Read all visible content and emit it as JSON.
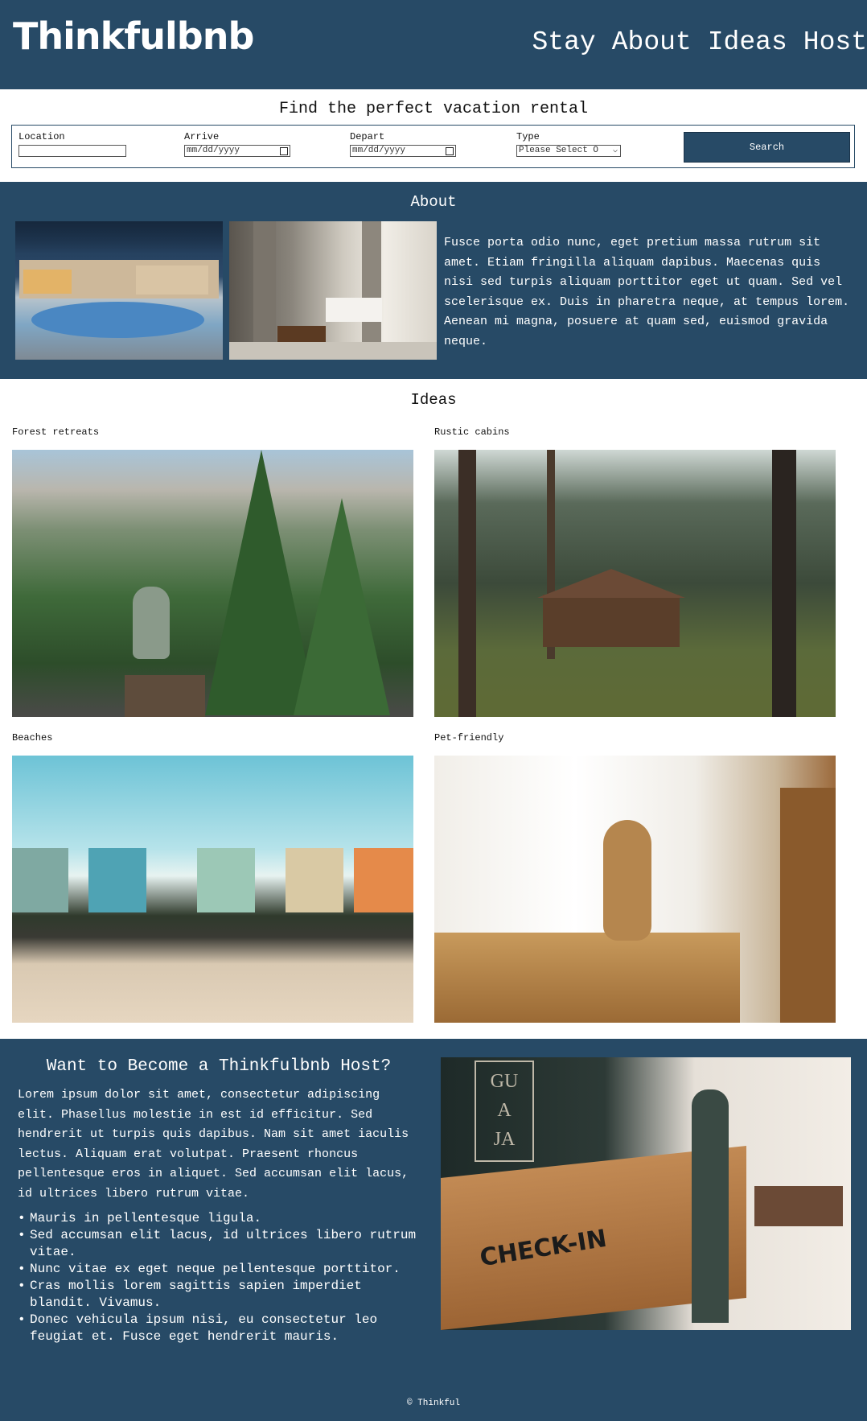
{
  "header": {
    "logo": "Thinkfulbnb",
    "nav": [
      "Stay",
      "About",
      "Ideas",
      "Host"
    ]
  },
  "search": {
    "title": "Find the perfect vacation rental",
    "location_label": "Location",
    "arrive_label": "Arrive",
    "arrive_placeholder": "mm/dd/yyyy",
    "depart_label": "Depart",
    "depart_placeholder": "mm/dd/yyyy",
    "type_label": "Type",
    "type_selected": "Please Select O",
    "button": "Search"
  },
  "about": {
    "title": "About",
    "text": "Fusce porta odio nunc, eget pretium massa rutrum sit amet. Etiam fringilla aliquam dapibus. Maecenas quis nisi sed turpis aliquam porttitor eget ut quam. Sed vel scelerisque ex. Duis in pharetra neque, at tempus lorem. Aenean mi magna, posuere at quam sed, euismod gravida neque."
  },
  "ideas": {
    "title": "Ideas",
    "items": [
      {
        "label": "Forest retreats"
      },
      {
        "label": "Rustic cabins"
      },
      {
        "label": "Beaches"
      },
      {
        "label": "Pet-friendly"
      }
    ]
  },
  "host": {
    "title": "Want to Become a Thinkfulbnb Host?",
    "text": "Lorem ipsum dolor sit amet, consectetur adipiscing elit. Phasellus molestie in est id efficitur. Sed hendrerit ut turpis quis dapibus. Nam sit amet iaculis lectus. Aliquam erat volutpat. Praesent rhoncus pellentesque eros in aliquet. Sed accumsan elit lacus, id ultrices libero rutrum vitae.",
    "list": [
      "Mauris in pellentesque ligula.",
      "Sed accumsan elit lacus, id ultrices libero rutrum vitae.",
      "Nunc vitae ex eget neque pellentesque porttitor.",
      "Cras mollis lorem sagittis sapien imperdiet blandit. Vivamus.",
      "Donec vehicula ipsum nisi, eu consectetur leo feugiat et. Fusce eget hendrerit mauris."
    ],
    "sign_text_1": "GU",
    "sign_text_2": "A",
    "sign_text_3": "JA",
    "desk_text": "CHECK-IN"
  },
  "footer": "© Thinkful"
}
